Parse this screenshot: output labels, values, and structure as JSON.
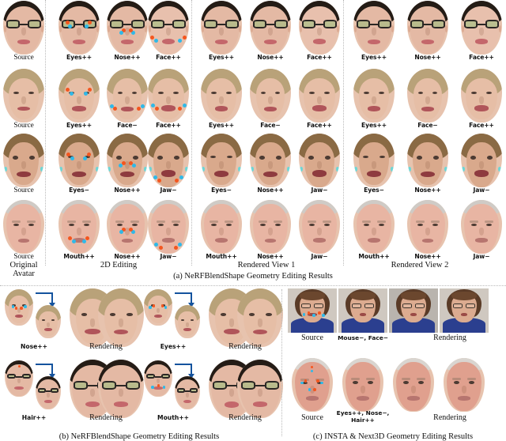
{
  "figure": {
    "panel_a_caption": "(a) NeRFBlendShape Geometry Editing Results",
    "panel_b_caption": "(b) NeRFBlendShape Geometry Editing Results",
    "panel_c_caption": "(c) INSTA & Next3D Geometry Editing Results"
  },
  "panel_a": {
    "group_labels": [
      "Original Avatar",
      "2D Editing",
      "Rendered View 1",
      "Rendered View 2"
    ],
    "rows": [
      {
        "subject": "asian-man-glasses",
        "cells": [
          {
            "label": "Source",
            "edit": "none",
            "markers": []
          },
          {
            "label": "Eyes++",
            "edit": "eyes",
            "markers": [
              "eyes"
            ]
          },
          {
            "label": "Nose++",
            "edit": "nose",
            "markers": [
              "nose"
            ]
          },
          {
            "label": "Face++",
            "edit": "face",
            "markers": [
              "face"
            ]
          },
          {
            "label": "Eyes++",
            "edit": "eyes",
            "markers": []
          },
          {
            "label": "Nose++",
            "edit": "nose",
            "markers": []
          },
          {
            "label": "Face++",
            "edit": "face",
            "markers": []
          },
          {
            "label": "Eyes++",
            "edit": "eyes",
            "markers": []
          },
          {
            "label": "Nose++",
            "edit": "nose",
            "markers": []
          },
          {
            "label": "Face++",
            "edit": "face",
            "markers": []
          }
        ]
      },
      {
        "subject": "older-woman-blonde",
        "cells": [
          {
            "label": "Source",
            "edit": "none",
            "markers": []
          },
          {
            "label": "Eyes++",
            "edit": "eyes",
            "markers": [
              "eyes"
            ]
          },
          {
            "label": "Face−",
            "edit": "face",
            "markers": [
              "face"
            ]
          },
          {
            "label": "Face++",
            "edit": "face",
            "markers": [
              "face"
            ]
          },
          {
            "label": "Eyes++",
            "edit": "eyes",
            "markers": []
          },
          {
            "label": "Face−",
            "edit": "face",
            "markers": []
          },
          {
            "label": "Face++",
            "edit": "face",
            "markers": []
          },
          {
            "label": "Eyes++",
            "edit": "eyes",
            "markers": []
          },
          {
            "label": "Face−",
            "edit": "face",
            "markers": []
          },
          {
            "label": "Face++",
            "edit": "face",
            "markers": []
          }
        ]
      },
      {
        "subject": "young-woman-brunette",
        "cells": [
          {
            "label": "Source",
            "edit": "none",
            "markers": []
          },
          {
            "label": "Eyes−",
            "edit": "eyes",
            "markers": [
              "eyes"
            ]
          },
          {
            "label": "Nose++",
            "edit": "nose",
            "markers": [
              "nose"
            ]
          },
          {
            "label": "Jaw−",
            "edit": "jaw",
            "markers": [
              "jaw"
            ]
          },
          {
            "label": "Eyes−",
            "edit": "eyes",
            "markers": []
          },
          {
            "label": "Nose++",
            "edit": "nose",
            "markers": []
          },
          {
            "label": "Jaw−",
            "edit": "jaw",
            "markers": []
          },
          {
            "label": "Eyes−",
            "edit": "eyes",
            "markers": []
          },
          {
            "label": "Nose++",
            "edit": "nose",
            "markers": []
          },
          {
            "label": "Jaw−",
            "edit": "jaw",
            "markers": []
          }
        ]
      },
      {
        "subject": "older-man-grayhair",
        "cells": [
          {
            "label": "Source",
            "edit": "none",
            "markers": []
          },
          {
            "label": "Mouth++",
            "edit": "mouth",
            "markers": [
              "mouth"
            ]
          },
          {
            "label": "Nose++",
            "edit": "nose",
            "markers": [
              "nose"
            ]
          },
          {
            "label": "Jaw−",
            "edit": "jaw",
            "markers": [
              "jaw"
            ]
          },
          {
            "label": "Mouth++",
            "edit": "mouth",
            "markers": []
          },
          {
            "label": "Nose++",
            "edit": "nose",
            "markers": []
          },
          {
            "label": "Jaw−",
            "edit": "jaw",
            "markers": []
          },
          {
            "label": "Mouth++",
            "edit": "mouth",
            "markers": []
          },
          {
            "label": "Nose++",
            "edit": "nose",
            "markers": []
          },
          {
            "label": "Jaw−",
            "edit": "jaw",
            "markers": []
          }
        ]
      }
    ]
  },
  "panel_b": {
    "rows": [
      {
        "groups": [
          {
            "edit_label": "Nose++",
            "render_label": "Rendering",
            "subject": "older-woman-blonde",
            "markers": [
              "nose"
            ]
          },
          {
            "edit_label": "Eyes++",
            "render_label": "Rendering",
            "subject": "older-woman-blonde",
            "markers": [
              "eyes"
            ]
          }
        ]
      },
      {
        "groups": [
          {
            "edit_label": "Hair++",
            "render_label": "Rendering",
            "subject": "asian-man-glasses",
            "markers": [
              "hair"
            ]
          },
          {
            "edit_label": "Mouth++",
            "render_label": "Rendering",
            "subject": "asian-man-glasses",
            "markers": [
              "mouth"
            ]
          }
        ]
      }
    ]
  },
  "panel_c": {
    "rows": [
      {
        "subject": "woman-glasses-photo",
        "cells": [
          {
            "label": "Source",
            "style": "serif",
            "markers": [
              "mouth",
              "face"
            ]
          },
          {
            "label": "Mouse−, Face−",
            "style": "sans",
            "markers": []
          },
          {
            "label": "Rendering",
            "style": "serif",
            "span": 2,
            "markers": []
          }
        ]
      },
      {
        "subject": "older-man-grayhair",
        "cells": [
          {
            "label": "Source",
            "style": "serif",
            "markers": [
              "eyes",
              "nose",
              "hair"
            ]
          },
          {
            "label": "Eyes++, Nose−,\nHair++",
            "style": "sans",
            "markers": []
          },
          {
            "label": "Rendering",
            "style": "serif",
            "span": 2,
            "markers": []
          }
        ]
      }
    ]
  },
  "colors": {
    "marker_warm": "#f4561f",
    "marker_cool": "#2fb9e8",
    "arrow": "#14539e",
    "divider": "#b9b9b9"
  }
}
